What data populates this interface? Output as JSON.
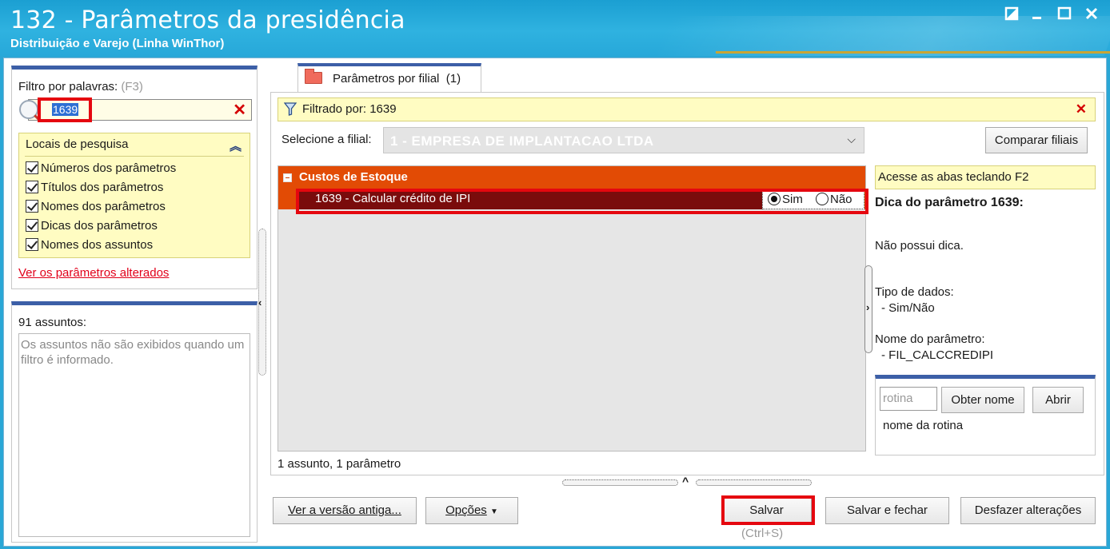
{
  "window": {
    "title": "132 - Parâmetros da presidência",
    "subtitle": "Distribuição e Varejo (Linha WinThor)",
    "controls": [
      "restore-icon",
      "minimize-icon",
      "maximize-icon",
      "close-icon"
    ]
  },
  "left": {
    "filter_label": "Filtro por palavras:",
    "filter_hint": "(F3)",
    "filter_value": "1639",
    "locais_title": "Locais de pesquisa",
    "locais": [
      {
        "label": "Números dos parâmetros",
        "checked": true
      },
      {
        "label": "Títulos dos parâmetros",
        "checked": true
      },
      {
        "label": "Nomes dos parâmetros",
        "checked": true
      },
      {
        "label": "Dicas dos parâmetros",
        "checked": true
      },
      {
        "label": "Nomes dos assuntos",
        "checked": true
      }
    ],
    "changed_link": "Ver os parâmetros alterados",
    "subjects_count": "91 assuntos:",
    "subjects_note": "Os assuntos não são exibidos quando um filtro é informado."
  },
  "tab": {
    "label": "Parâmetros por filial",
    "count": "(1)"
  },
  "filter_bar": {
    "text": "Filtrado por: 1639"
  },
  "filial": {
    "label": "Selecione a filial:",
    "value": "1 - EMPRESA DE IMPLANTACAO LTDA",
    "compare_button": "Comparar filiais"
  },
  "tree": {
    "group": "Custos de Estoque",
    "item": "1639 - Calcular crédito de IPI",
    "options": [
      {
        "label": "Sim",
        "selected": true
      },
      {
        "label": "Não",
        "selected": false
      }
    ]
  },
  "status": "1 assunto, 1 parâmetro",
  "side": {
    "hint": "Acesse as abas teclando F2",
    "tip_title": "Dica do parâmetro 1639:",
    "tip_text": "Não possui dica.",
    "type_label": "Tipo de dados:",
    "type_value": "- Sim/Não",
    "name_label": "Nome do parâmetro:",
    "name_value": "- FIL_CALCCREDIPI",
    "rotina_placeholder": "rotina",
    "get_name_button": "Obter nome",
    "open_button": "Abrir",
    "rotina_name": "nome da rotina"
  },
  "footer": {
    "old_version_button": "Ver a versão antiga...",
    "options_button": "Opções",
    "save_button": "Salvar",
    "save_shortcut": "(Ctrl+S)",
    "save_close_button": "Salvar e fechar",
    "undo_button": "Desfazer alterações"
  },
  "colors": {
    "titlebar": "#2aa7d6",
    "accent_blue": "#3c5fa7",
    "group_orange": "#e24b05",
    "selected_row": "#7a0c0c",
    "highlight_red": "#e5070f",
    "info_yellow": "#fffcc2"
  }
}
